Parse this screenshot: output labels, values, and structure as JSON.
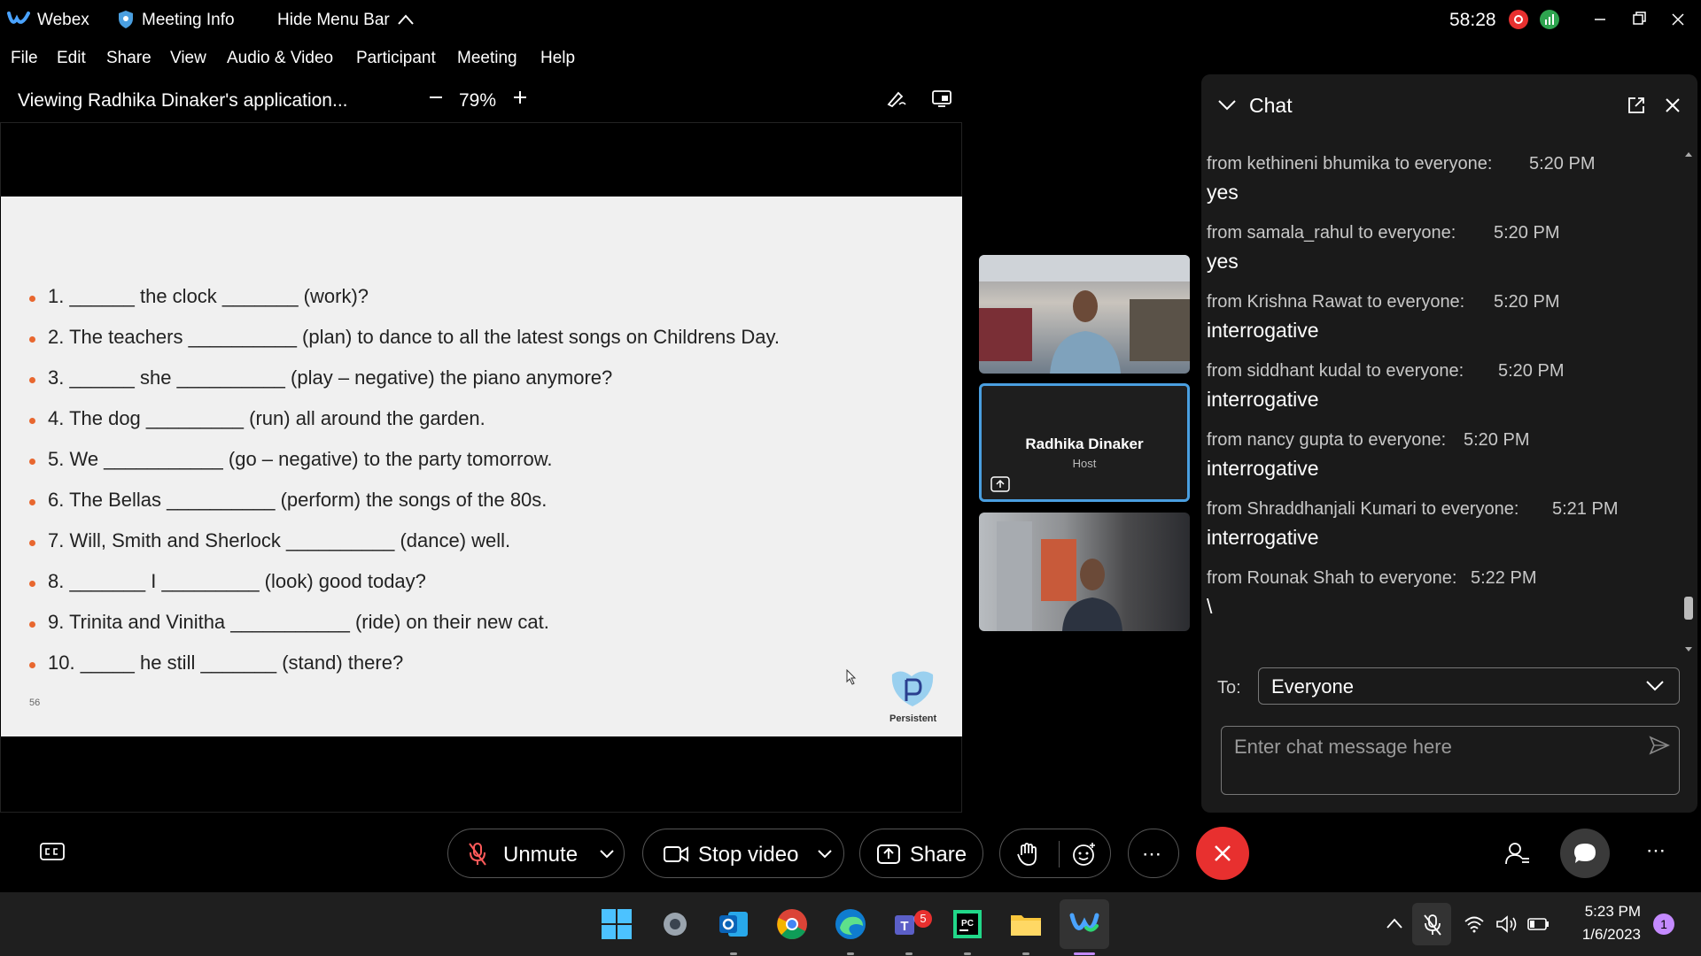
{
  "titlebar": {
    "app_name": "Webex",
    "meeting_info": "Meeting Info",
    "hide_menu": "Hide Menu Bar",
    "timer": "58:28"
  },
  "menu": [
    "File",
    "Edit",
    "Share",
    "View",
    "Audio & Video",
    "Participant",
    "Meeting",
    "Help"
  ],
  "viewing": {
    "title": "Viewing Radhika Dinaker's application...",
    "zoom": "79%"
  },
  "slide": {
    "lines": [
      "1. ______ the clock _______ (work)?",
      "2. The teachers __________ (plan) to dance to all the latest songs on Childrens Day.",
      "3. ______ she __________ (play – negative) the piano anymore?",
      "4. The dog _________ (run) all around the garden.",
      "5. We ___________ (go – negative) to the party tomorrow.",
      "6. The Bellas __________ (perform) the songs of the 80s.",
      "7. Will, Smith and Sherlock __________ (dance) well.",
      "8. _______ I _________ (look) good today?",
      "9. Trinita and Vinitha ___________ (ride) on their new cat.",
      "10. _____ he still _______ (stand) there?"
    ],
    "page_number": "56",
    "logo_text": "Persistent"
  },
  "participants": {
    "host_name": "Radhika Dinaker",
    "host_role": "Host"
  },
  "chat": {
    "title": "Chat",
    "messages": [
      {
        "from": "from kethineni bhumika to everyone:",
        "time": "5:20 PM",
        "text": "yes"
      },
      {
        "from": "from samala_rahul to everyone:",
        "time": "5:20 PM",
        "text": "yes"
      },
      {
        "from": "from Krishna Rawat to everyone:",
        "time": "5:20 PM",
        "text": "interrogative"
      },
      {
        "from": "from siddhant kudal to everyone:",
        "time": "5:20 PM",
        "text": "interrogative"
      },
      {
        "from": "from nancy gupta to everyone:",
        "time": "5:20 PM",
        "text": "interrogative"
      },
      {
        "from": "from Shraddhanjali Kumari to everyone:",
        "time": "5:21 PM",
        "text": "interrogative"
      },
      {
        "from": "from Rounak Shah to everyone:",
        "time": "5:22 PM",
        "text": "\\"
      }
    ],
    "to_label": "To:",
    "to_value": "Everyone",
    "input_placeholder": "Enter chat message here"
  },
  "controls": {
    "unmute": "Unmute",
    "stop_video": "Stop video",
    "share": "Share"
  },
  "taskbar": {
    "time": "5:23 PM",
    "date": "1/6/2023",
    "teams_badge": "5",
    "notification_count": "1"
  },
  "colors": {
    "accent_blue": "#4a9fe0",
    "end_red": "#e8302f",
    "bullet_orange": "#e8672f"
  }
}
